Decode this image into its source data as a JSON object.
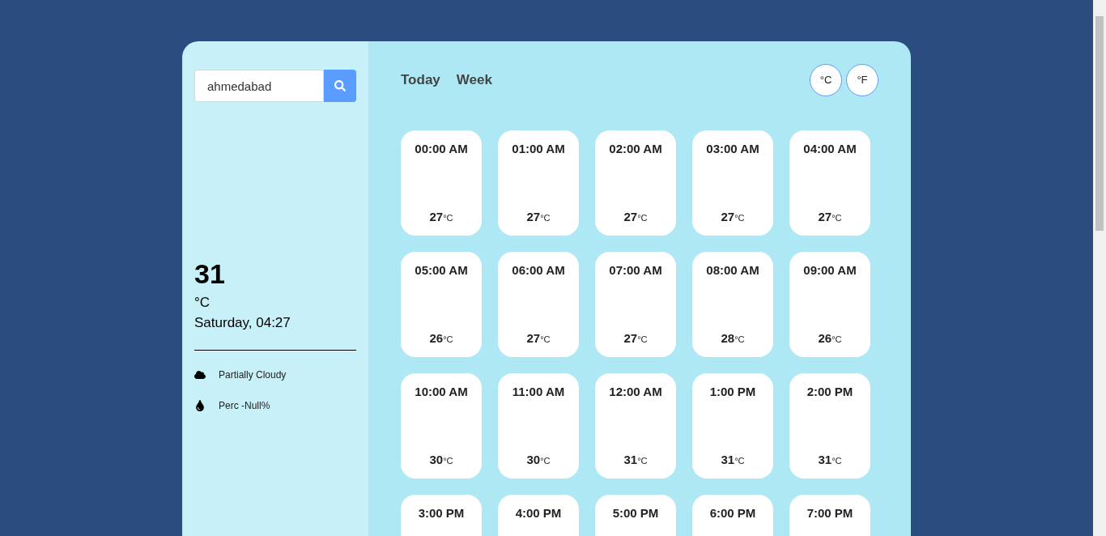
{
  "search": {
    "value": "ahmedabad"
  },
  "current": {
    "temperature": "31",
    "unit": "°C",
    "datetime": "Saturday, 04:27"
  },
  "conditions": [
    {
      "kind": "cloud",
      "text": "Partially Cloudy"
    },
    {
      "kind": "drop",
      "text": "Perc -Null%"
    }
  ],
  "tabs": [
    "Today",
    "Week"
  ],
  "unit_buttons": [
    "°C",
    "°F"
  ],
  "hours": [
    {
      "time": "00:00 AM",
      "temp": "27",
      "unit": "°C"
    },
    {
      "time": "01:00 AM",
      "temp": "27",
      "unit": "°C"
    },
    {
      "time": "02:00 AM",
      "temp": "27",
      "unit": "°C"
    },
    {
      "time": "03:00 AM",
      "temp": "27",
      "unit": "°C"
    },
    {
      "time": "04:00 AM",
      "temp": "27",
      "unit": "°C"
    },
    {
      "time": "05:00 AM",
      "temp": "26",
      "unit": "°C"
    },
    {
      "time": "06:00 AM",
      "temp": "27",
      "unit": "°C"
    },
    {
      "time": "07:00 AM",
      "temp": "27",
      "unit": "°C"
    },
    {
      "time": "08:00 AM",
      "temp": "28",
      "unit": "°C"
    },
    {
      "time": "09:00 AM",
      "temp": "26",
      "unit": "°C"
    },
    {
      "time": "10:00 AM",
      "temp": "30",
      "unit": "°C"
    },
    {
      "time": "11:00 AM",
      "temp": "30",
      "unit": "°C"
    },
    {
      "time": "12:00 AM",
      "temp": "31",
      "unit": "°C"
    },
    {
      "time": "1:00 PM",
      "temp": "31",
      "unit": "°C"
    },
    {
      "time": "2:00 PM",
      "temp": "31",
      "unit": "°C"
    },
    {
      "time": "3:00 PM"
    },
    {
      "time": "4:00 PM"
    },
    {
      "time": "5:00 PM"
    },
    {
      "time": "6:00 PM"
    },
    {
      "time": "7:00 PM"
    }
  ]
}
